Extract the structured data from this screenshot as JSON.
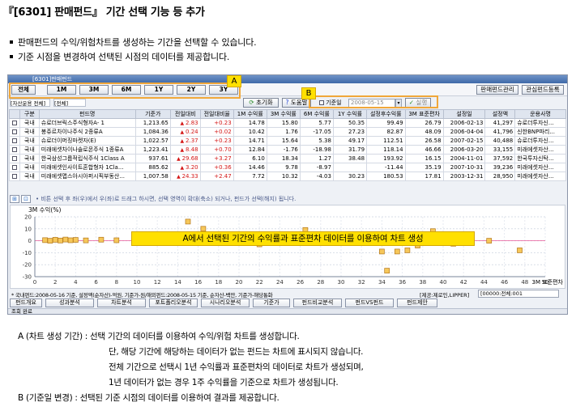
{
  "heading": "『[6301] 판매펀드』 기간 선택 기능 등 추가",
  "bullets": [
    "판매펀드의 수익/위험차트를 생성하는 기간을 선택할 수 있습니다.",
    "기준 시점을 변경하여 선택된 시점의 데이터를 제공합니다."
  ],
  "window": {
    "title": "[6301]판매펀드",
    "period_buttons": [
      "전체",
      "1M",
      "3M",
      "6M",
      "1Y",
      "2Y",
      "3Y"
    ],
    "right_buttons": [
      "판매펀드관리",
      "관심펀드등록"
    ],
    "filter_left": "[자산운용 전체]",
    "filter_mid": "[전체]",
    "reset_label": "초기화",
    "help_label": "도움말",
    "basedate_label": "기준일",
    "basedate_value": "2008-05-15",
    "apply_label": "실행",
    "annotation_a": "A",
    "annotation_b": "B",
    "table": {
      "headers": [
        "구분",
        "펀드명",
        "기준가",
        "전일대비",
        "전일대비율",
        "1M 수익률",
        "3M 수익률",
        "6M 수익률",
        "1Y 수익률",
        "설정후수익률",
        "3M 표준편차",
        "설정일",
        "설정액",
        "운용사명"
      ],
      "rows": [
        [
          "국내",
          "슈로더브릭스주식형자A- 1",
          "1,213.65",
          "2.83",
          "+0.23",
          "14.78",
          "15.80",
          "5.77",
          "50.35",
          "99.49",
          "26.79",
          "2006-02-13",
          "41,297",
          "슈로더투자신..."
        ],
        [
          "국내",
          "봉쥬르차이나주식 2종류A",
          "1,084.36",
          "0.24",
          "+0.02",
          "10.42",
          "1.76",
          "-17.05",
          "27.23",
          "82.87",
          "48.09",
          "2006-04-04",
          "41,796",
          "신한BNP파리..."
        ],
        [
          "국내",
          "슈로더이머징마켓자(E)",
          "1,022.57",
          "2.37",
          "+0.23",
          "14.71",
          "15.64",
          "5.38",
          "49.17",
          "112.51",
          "26.58",
          "2007-02-15",
          "40,488",
          "슈로더투자신..."
        ],
        [
          "국내",
          "미래에셋차이나솔로몬주식 1종류A",
          "1,223.41",
          "8.48",
          "+0.70",
          "12.84",
          "-1.76",
          "-18.98",
          "31.79",
          "118.14",
          "46.66",
          "2006-03-20",
          "33,155",
          "미래에셋자산..."
        ],
        [
          "국내",
          "한국삼성그룹적립식주식 1Class A",
          "937.61",
          "29.68",
          "+3.27",
          "6.10",
          "18.34",
          "1.27",
          "38.48",
          "193.92",
          "16.15",
          "2004-11-01",
          "37,592",
          "한국투자신탁..."
        ],
        [
          "국내",
          "미래에셋인사이트혼합형자 1Cla...",
          "885.62",
          "3.20",
          "+0.36",
          "14.46",
          "9.78",
          "-8.97",
          "",
          "-11.44",
          "35.19",
          "2007-10-31",
          "39,236",
          "미래에셋자산..."
        ],
        [
          "국내",
          "미래에셋맵스아시아퍼시픽부동산...",
          "1,007.58",
          "24.33",
          "+2.47",
          "7.72",
          "10.32",
          "-4.03",
          "30.23",
          "180.53",
          "17.81",
          "2003-12-31",
          "28,950",
          "미래에셋자산..."
        ]
      ],
      "change_up": [
        true,
        true,
        true,
        true,
        true,
        true,
        true
      ]
    },
    "chart_hint": "• 비튼 선택 후 좌(우)에서 우(좌)로 드래그 하시면, 선택 영역이 확대(축소) 되거나, 펀드가 선택(해지) 됩니다.",
    "chart_data": {
      "type": "scatter",
      "title": "",
      "ylabel": "3M 수익(%)",
      "xlabel": "3M 표준편차",
      "xlim": [
        0,
        50
      ],
      "ylim": [
        -30,
        20
      ],
      "xticks": [
        0,
        2,
        4,
        6,
        8,
        10,
        12,
        14,
        16,
        18,
        20,
        22,
        24,
        26,
        28,
        30,
        32,
        34,
        36,
        38,
        40,
        42,
        44,
        46,
        48,
        50
      ],
      "yticks": [
        20,
        10,
        0,
        -10,
        -20,
        -30
      ],
      "points": [
        {
          "x": 1.0,
          "y": 0.5
        },
        {
          "x": 1.5,
          "y": 0.0
        },
        {
          "x": 2.0,
          "y": 0.8
        },
        {
          "x": 2.5,
          "y": 0.2
        },
        {
          "x": 3.0,
          "y": 1.0
        },
        {
          "x": 3.5,
          "y": 0.4
        },
        {
          "x": 4.0,
          "y": 0.7
        },
        {
          "x": 5.0,
          "y": 0.3
        },
        {
          "x": 6.5,
          "y": 0.9
        },
        {
          "x": 8.0,
          "y": 0.4
        },
        {
          "x": 10.0,
          "y": 1.2
        },
        {
          "x": 11.0,
          "y": 0.2
        },
        {
          "x": 15.0,
          "y": 16.0
        },
        {
          "x": 16.5,
          "y": 10.0
        },
        {
          "x": 19.0,
          "y": 4.5
        },
        {
          "x": 22.0,
          "y": -3.0
        },
        {
          "x": 26.5,
          "y": 9.0
        },
        {
          "x": 32.0,
          "y": 4.0
        },
        {
          "x": 34.0,
          "y": -9.0
        },
        {
          "x": 35.5,
          "y": -9.0
        },
        {
          "x": 34.5,
          "y": -25.0
        },
        {
          "x": 36.5,
          "y": -8.0
        },
        {
          "x": 37.5,
          "y": -4.0
        },
        {
          "x": 39.0,
          "y": 8.0
        },
        {
          "x": 41.0,
          "y": -2.5
        },
        {
          "x": 44.5,
          "y": 0.0
        },
        {
          "x": 47.5,
          "y": -8.0
        }
      ]
    },
    "chart_overlay": "A에서 선택된 기간의 수익률과 표준편차 데이터를 이용하여 차트 생성",
    "footnote": "* 국내펀드:2008-05-16 기준, 설정액(순자산)-억원, 기준가-원/해외펀드:2008-05-15 기준, 순자산-백만, 기준가-해당통화",
    "source": "[제공:제로인,LIPPER]",
    "combo": "[00000:전체:001",
    "tabs": [
      "펀드개요",
      "성과분석",
      "차트분석",
      "포트폴리오분석",
      "시나리오분석",
      "기준가",
      "펀드비교분석",
      "펀드VS펀드",
      "펀드제안"
    ],
    "status": "조회 완료"
  },
  "descriptions": [
    "A (차트 생성 기간) : 선택 기간의 데이터를 이용하여 수익/위험 차트를 생성합니다.",
    "단, 해당 기간에 해당하는 데이터가 없는 펀드는 차트에 표시되지 않습니다.",
    "전체 기간으로 선택시 1년 수익률과 표준편차의 데이터로 차트가 생성되며,",
    "1년 데이터가 없는 경우 1주 수익률을 기준으로 차트가 생성됩니다.",
    "B (기준일 변경) : 선택된 기준 시점의 데이터를 이용하여 결과를 제공합니다."
  ]
}
